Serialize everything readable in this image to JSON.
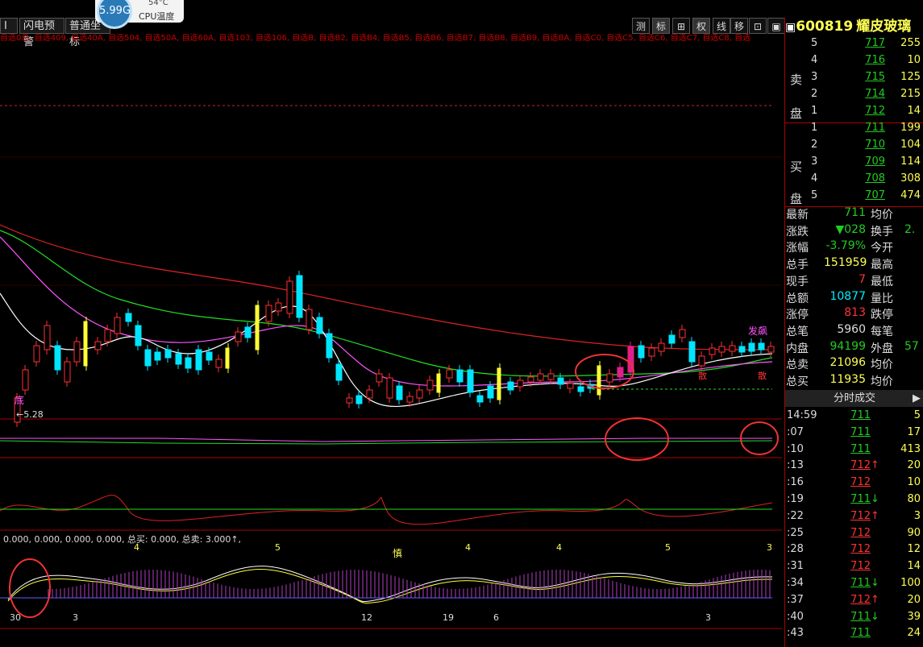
{
  "toolbar": {
    "left_buttons": [
      "闪电预警",
      "普通坐标"
    ],
    "right_buttons": [
      "测",
      "标",
      "⊞",
      "权",
      "线",
      "移",
      "⊡",
      "▣"
    ],
    "active_right": "标"
  },
  "cpu_widget": {
    "usage": "5.99G",
    "temp": "54°C",
    "label": "CPU温度"
  },
  "formula_line": "自选0总, 自选409, 自选40A, 自选504, 自选50A, 自选60A, 自选103, 自选106, 自选B, 自选B2, 自选B4, 自选B5, 自选B6, 自选B7, 自选B8, 自选B9, 自选BA, 自选C0, 自选C5, 自选C6, 自选C7, 自选C8, 自选",
  "chart_labels": {
    "low_price": "5.28",
    "bottom_tag": "底",
    "signals": [
      "发飙",
      "散",
      "散",
      "慎"
    ],
    "sub_status": "0.000, 0.000, 0.000, 0.000, 总买: 0.000, 总卖: 3.000↑,",
    "axis_dates": [
      "30",
      "3",
      "12",
      "19",
      "6",
      "3"
    ],
    "wave_counts": [
      "4",
      "5",
      "4",
      "4",
      "5",
      "3"
    ]
  },
  "colors": {
    "up": "#ff3030",
    "down": "#00e5ff",
    "ma5": "#ffffff",
    "ma10": "#ff55ff",
    "ma20": "#22dd22",
    "ma60": "#dd2222",
    "accent": "#ffff33"
  },
  "stock": {
    "code": "600819",
    "name": "耀皮玻璃"
  },
  "orderbook": {
    "sell_label": [
      "卖",
      "盘"
    ],
    "buy_label": [
      "买",
      "盘"
    ],
    "sell": [
      {
        "level": "5",
        "price": "717",
        "vol": "255"
      },
      {
        "level": "4",
        "price": "716",
        "vol": "10"
      },
      {
        "level": "3",
        "price": "715",
        "vol": "125"
      },
      {
        "level": "2",
        "price": "714",
        "vol": "215"
      },
      {
        "level": "1",
        "price": "712",
        "vol": "14"
      }
    ],
    "buy": [
      {
        "level": "1",
        "price": "711",
        "vol": "199"
      },
      {
        "level": "2",
        "price": "710",
        "vol": "104"
      },
      {
        "level": "3",
        "price": "709",
        "vol": "114"
      },
      {
        "level": "4",
        "price": "708",
        "vol": "308"
      },
      {
        "level": "5",
        "price": "707",
        "vol": "474"
      }
    ]
  },
  "quote": [
    {
      "k": "最新",
      "v": "711",
      "vc": "#2c2",
      "k2": "均价",
      "v2": ""
    },
    {
      "k": "涨跌",
      "v": "▼028",
      "vc": "#2c2",
      "k2": "换手",
      "v2": "2."
    },
    {
      "k": "涨幅",
      "v": "-3.79%",
      "vc": "#2c2",
      "k2": "今开",
      "v2": ""
    },
    {
      "k": "总手",
      "v": "151959",
      "vc": "#ff5",
      "k2": "最高",
      "v2": ""
    },
    {
      "k": "现手",
      "v": "7",
      "vc": "#f33",
      "k2": "最低",
      "v2": ""
    },
    {
      "k": "总额",
      "v": "10877",
      "vc": "#0ef",
      "k2": "量比",
      "v2": ""
    },
    {
      "k": "涨停",
      "v": "813",
      "vc": "#f33",
      "k2": "跌停",
      "v2": ""
    },
    {
      "k": "总笔",
      "v": "5960",
      "vc": "#ddd",
      "k2": "每笔",
      "v2": ""
    },
    {
      "k": "内盘",
      "v": "94199",
      "vc": "#2c2",
      "k2": "外盘",
      "v2": "57"
    },
    {
      "k": "总卖",
      "v": "21096",
      "vc": "#ff5",
      "k2": "均价",
      "v2": ""
    },
    {
      "k": "总买",
      "v": "11935",
      "vc": "#ff5",
      "k2": "均价",
      "v2": ""
    }
  ],
  "ticks_title": "分时成交",
  "ticks": [
    {
      "t": "14:59",
      "p": "711",
      "a": "",
      "v": "5",
      "c": "#2c2"
    },
    {
      "t": ":07",
      "p": "711",
      "a": "",
      "v": "17",
      "c": "#2c2"
    },
    {
      "t": ":10",
      "p": "711",
      "a": "",
      "v": "413",
      "c": "#2c2"
    },
    {
      "t": ":13",
      "p": "712",
      "a": "↑",
      "v": "20",
      "c": "#f33"
    },
    {
      "t": ":16",
      "p": "712",
      "a": "",
      "v": "10",
      "c": "#f33"
    },
    {
      "t": ":19",
      "p": "711",
      "a": "↓",
      "v": "80",
      "c": "#2c2"
    },
    {
      "t": ":22",
      "p": "712",
      "a": "↑",
      "v": "3",
      "c": "#f33"
    },
    {
      "t": ":25",
      "p": "712",
      "a": "",
      "v": "90",
      "c": "#f33"
    },
    {
      "t": ":28",
      "p": "712",
      "a": "",
      "v": "12",
      "c": "#f33"
    },
    {
      "t": ":31",
      "p": "712",
      "a": "",
      "v": "14",
      "c": "#f33"
    },
    {
      "t": ":34",
      "p": "711",
      "a": "↓",
      "v": "100",
      "c": "#2c2"
    },
    {
      "t": ":37",
      "p": "712",
      "a": "↑",
      "v": "20",
      "c": "#f33"
    },
    {
      "t": ":40",
      "p": "711",
      "a": "↓",
      "v": "39",
      "c": "#2c2"
    },
    {
      "t": ":43",
      "p": "711",
      "a": "",
      "v": "24",
      "c": "#2c2"
    }
  ]
}
